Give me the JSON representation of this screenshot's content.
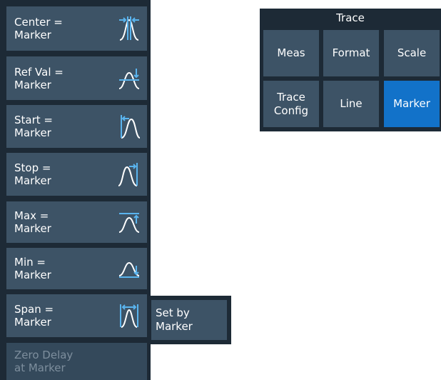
{
  "marker_functions": {
    "buttons": [
      {
        "line1": "Center =",
        "line2": "Marker",
        "icon": "center-marker-icon",
        "enabled": true
      },
      {
        "line1": "Ref Val =",
        "line2": "Marker",
        "icon": "ref-val-marker-icon",
        "enabled": true
      },
      {
        "line1": "Start =",
        "line2": "Marker",
        "icon": "start-marker-icon",
        "enabled": true
      },
      {
        "line1": "Stop =",
        "line2": "Marker",
        "icon": "stop-marker-icon",
        "enabled": true
      },
      {
        "line1": "Max =",
        "line2": "Marker",
        "icon": "max-marker-icon",
        "enabled": true
      },
      {
        "line1": "Min =",
        "line2": "Marker",
        "icon": "min-marker-icon",
        "enabled": true
      },
      {
        "line1": "Span =",
        "line2": "Marker",
        "icon": "span-marker-icon",
        "enabled": true
      },
      {
        "line1": "Zero Delay",
        "line2": "at Marker",
        "enabled": false
      }
    ]
  },
  "span_submenu": {
    "line1": "Set by",
    "line2": "Marker"
  },
  "trace_menu": {
    "title": "Trace",
    "buttons": [
      {
        "label": "Meas"
      },
      {
        "label": "Format"
      },
      {
        "label": "Scale"
      },
      {
        "line1": "Trace",
        "line2": "Config"
      },
      {
        "label": "Line"
      },
      {
        "label": "Marker",
        "active": true
      }
    ]
  },
  "colors": {
    "panel_background": "#1d2a36",
    "button_background": "#3d5366",
    "active_button": "#1272c9",
    "icon_accent": "#5ab4ee",
    "disabled_text": "#7d8e9d"
  }
}
